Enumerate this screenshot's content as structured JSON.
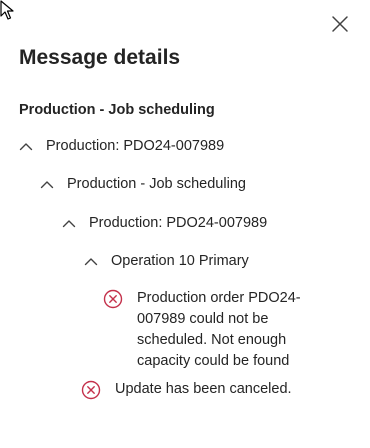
{
  "panel": {
    "title": "Message details",
    "close_icon": "close-icon",
    "cursor_icon": "mouse-pointer-icon"
  },
  "group": {
    "label": "Production - Job scheduling"
  },
  "tree": [
    {
      "label": "Production: PDO24-007989",
      "expanded": true,
      "icon": "chevron-up-icon"
    },
    {
      "label": "Production - Job scheduling",
      "expanded": true,
      "icon": "chevron-up-icon"
    },
    {
      "label": "Production: PDO24-007989",
      "expanded": true,
      "icon": "chevron-up-icon"
    },
    {
      "label": "Operation 10 Primary",
      "expanded": true,
      "icon": "chevron-up-icon"
    }
  ],
  "messages": [
    {
      "icon": "error-circle-icon",
      "lines": [
        "Production order PDO24-",
        "007989 could not be",
        "scheduled. Not enough",
        "capacity could be found"
      ]
    },
    {
      "icon": "error-circle-icon",
      "lines": [
        "Update has been canceled."
      ]
    }
  ],
  "colors": {
    "text": "#242424",
    "error": "#c4314b",
    "icon": "#424242"
  }
}
